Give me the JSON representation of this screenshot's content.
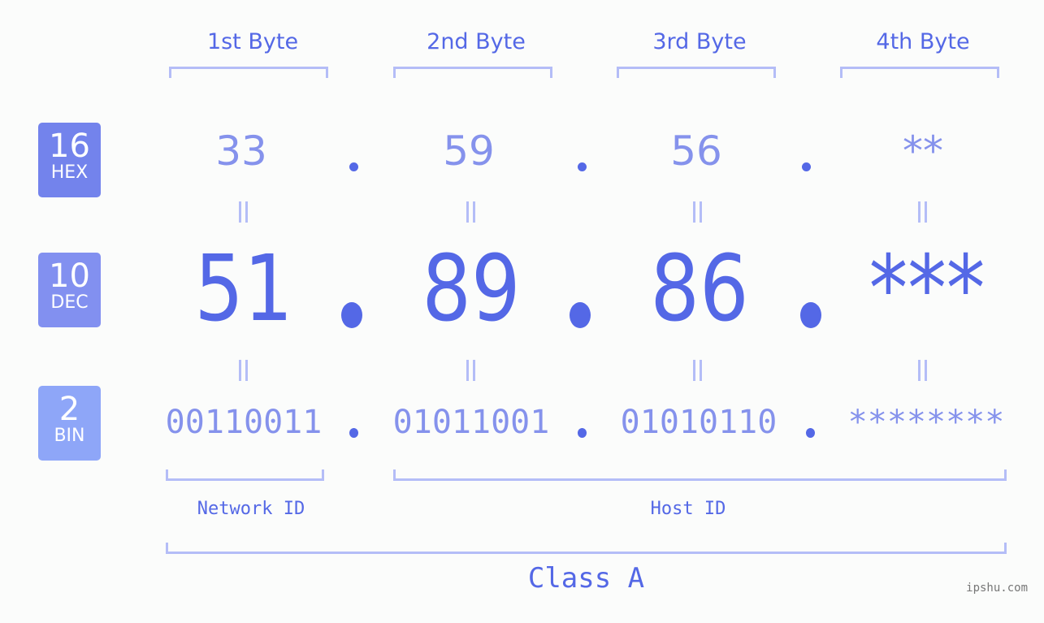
{
  "ip_address": "51.89.86.***",
  "byte_headers": [
    "1st Byte",
    "2nd Byte",
    "3rd Byte",
    "4th Byte"
  ],
  "badges": [
    {
      "num": "16",
      "label": "HEX",
      "color": "#7383ec"
    },
    {
      "num": "10",
      "label": "DEC",
      "color": "#8290f0"
    },
    {
      "num": "2",
      "label": "BIN",
      "color": "#8ea6f8"
    }
  ],
  "hex": [
    "33",
    "59",
    "56",
    "**"
  ],
  "dec": [
    "51",
    "89",
    "86",
    "***"
  ],
  "bin": [
    "00110011",
    "01011001",
    "01010110",
    "********"
  ],
  "separator": ".",
  "network_id_label": "Network ID",
  "host_id_label": "Host ID",
  "class_label": "Class A",
  "watermark": "ipshu.com",
  "colors": {
    "primary": "#5468e6",
    "secondary": "#8592ec",
    "bracket": "#b4bdf7",
    "background": "#fbfcfb"
  }
}
